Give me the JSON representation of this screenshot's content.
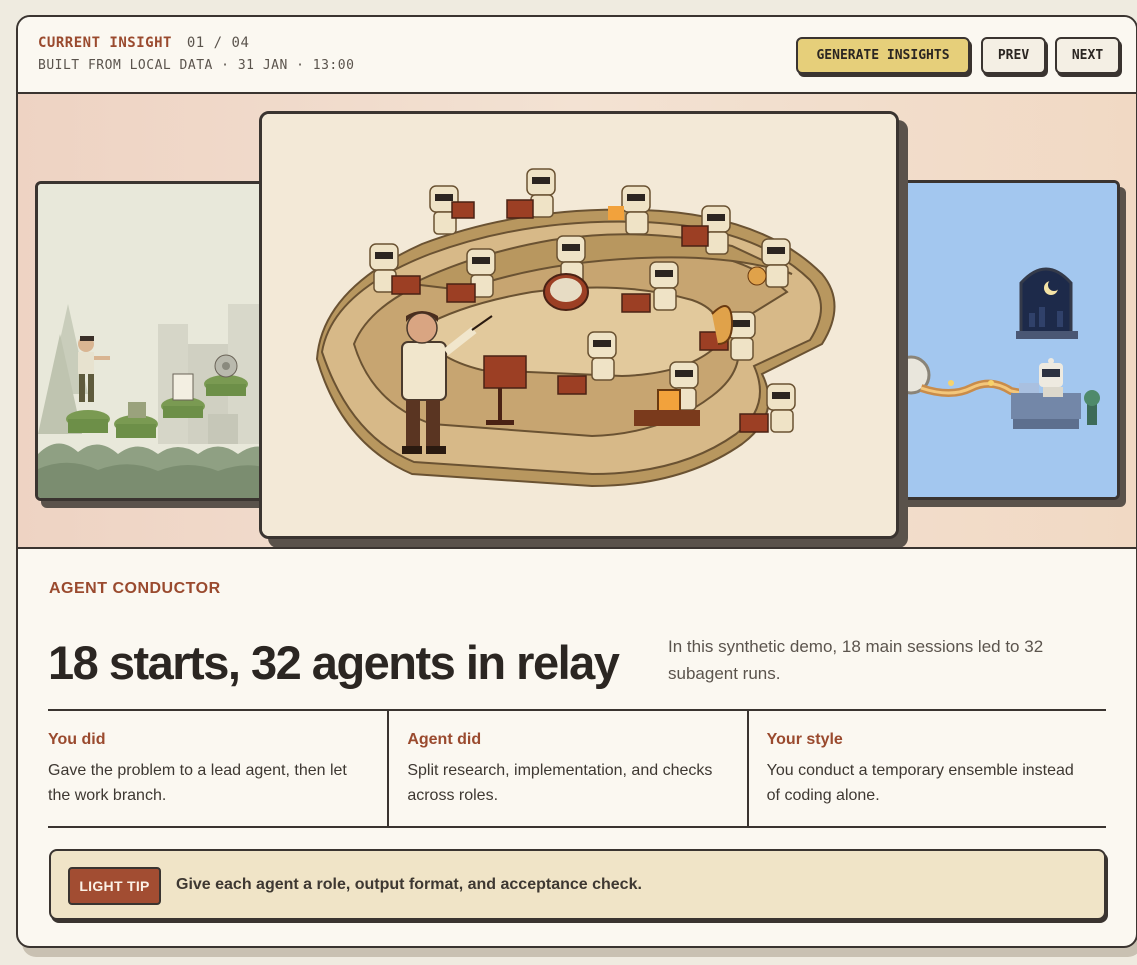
{
  "header": {
    "kicker": "CURRENT INSIGHT",
    "counter": "01 / 04",
    "subtitle": "BUILT FROM LOCAL DATA · 31 JAN · 13:00",
    "buttons": {
      "generate": "GENERATE INSIGHTS",
      "prev": "PREV",
      "next": "NEXT"
    }
  },
  "hero": {
    "left_image": "pixel-art-path-of-floating-islands",
    "center_image": "pixel-art-robot-orchestra-with-conductor",
    "right_image": "pixel-art-robot-at-desk-with-night-window"
  },
  "insight": {
    "eyebrow": "AGENT CONDUCTOR",
    "headline": "18 starts, 32 agents in relay",
    "summary": "In this synthetic demo, 18 main sessions led to 32 subagent runs.",
    "columns": [
      {
        "title": "You did",
        "text": "Gave the problem to a lead agent, then let the work branch."
      },
      {
        "title": "Agent did",
        "text": "Split research, implementation, and checks across roles."
      },
      {
        "title": "Your style",
        "text": "You conduct a temporary ensemble instead of coding alone."
      }
    ],
    "tip": {
      "badge": "LIGHT TIP",
      "text": "Give each agent a role, output format, and acceptance check."
    }
  },
  "colors": {
    "accent": "#9a4a2e",
    "button_primary": "#e6cf7a",
    "tip_bg": "#f0e4c7",
    "badge": "#a24d32"
  }
}
